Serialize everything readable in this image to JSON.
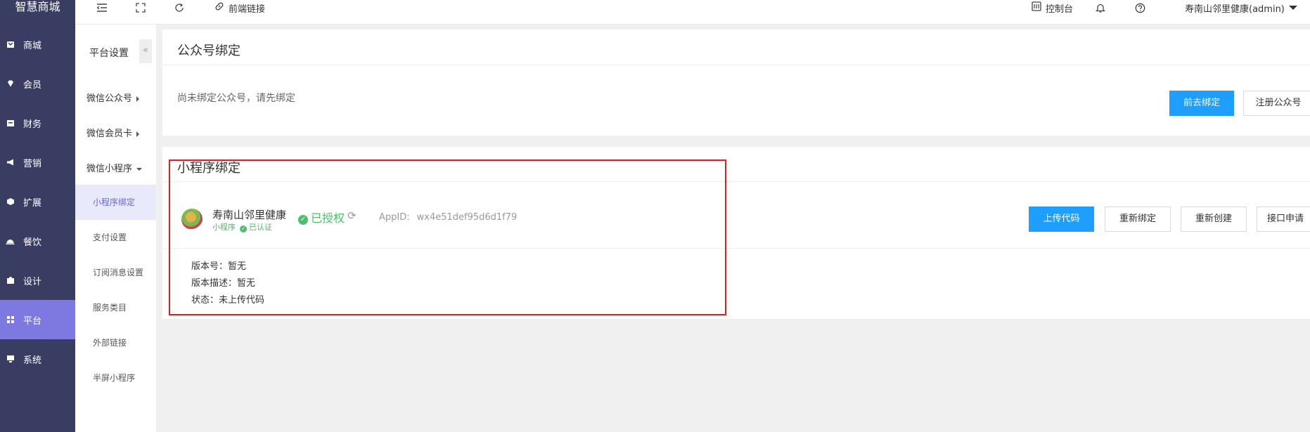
{
  "brand": {
    "name": "智慧商城"
  },
  "sidebar": {
    "items": [
      {
        "label": "商城",
        "icon": "store-icon"
      },
      {
        "label": "会员",
        "icon": "diamond-icon"
      },
      {
        "label": "财务",
        "icon": "wallet-icon"
      },
      {
        "label": "营销",
        "icon": "megaphone-icon"
      },
      {
        "label": "扩展",
        "icon": "cube-icon"
      },
      {
        "label": "餐饮",
        "icon": "dish-icon"
      },
      {
        "label": "设计",
        "icon": "puzzle-icon"
      },
      {
        "label": "平台",
        "icon": "grid-icon",
        "active": true
      },
      {
        "label": "系统",
        "icon": "monitor-icon"
      }
    ]
  },
  "topbar": {
    "frontend_link": "前端链接",
    "console": "控制台",
    "user": "寿南山邻里健康(admin)"
  },
  "submenu": {
    "title": "平台设置",
    "collapse": "«",
    "groups": {
      "wechat_official": "微信公众号",
      "wechat_card": "微信会员卡",
      "wechat_mini": "微信小程序"
    },
    "items": [
      {
        "label": "小程序绑定",
        "active": true
      },
      {
        "label": "支付设置"
      },
      {
        "label": "订阅消息设置"
      },
      {
        "label": "服务类目"
      },
      {
        "label": "外部链接"
      },
      {
        "label": "半屏小程序"
      }
    ]
  },
  "official_account": {
    "title": "公众号绑定",
    "hint": "尚未绑定公众号，请先绑定",
    "bind_button": "前去绑定",
    "register_button": "注册公众号"
  },
  "mini_program": {
    "title": "小程序绑定",
    "app_name": "寿南山邻里健康",
    "app_type": "小程序",
    "verified": "已认证",
    "auth_status": "已授权",
    "appid_label": "AppID:",
    "appid_value": "wx4e51def95d6d1f79",
    "buttons": {
      "upload": "上传代码",
      "rebind": "重新绑定",
      "recreate": "重新创建",
      "api_apply": "接口申请"
    },
    "version_no": "版本号：暂无",
    "version_desc": "版本描述：暂无",
    "status": "状态：未上传代码"
  },
  "colors": {
    "sidebar_bg": "#393d62",
    "sidebar_active": "#7d79e0",
    "primary": "#1e9fff",
    "success": "#4cbe6c",
    "highlight_border": "#e02020"
  }
}
